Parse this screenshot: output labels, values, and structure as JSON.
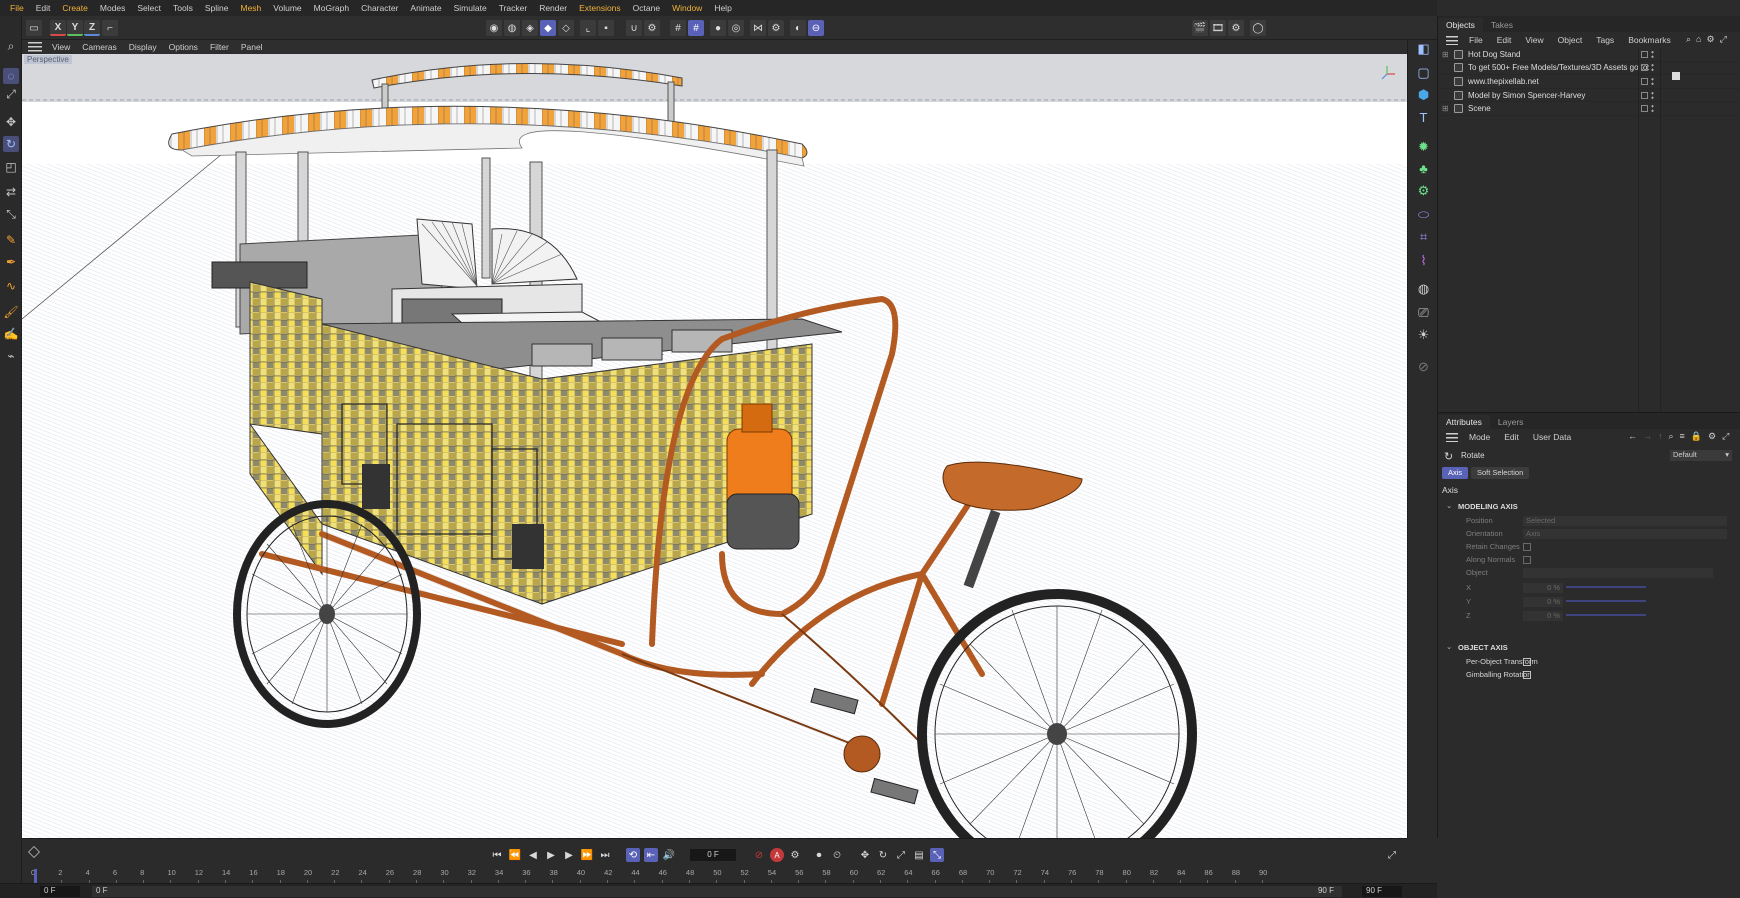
{
  "menubar": {
    "items": [
      {
        "label": "File",
        "hl": true
      },
      {
        "label": "Edit",
        "hl": false
      },
      {
        "label": "Create",
        "hl": true
      },
      {
        "label": "Modes",
        "hl": false
      },
      {
        "label": "Select",
        "hl": false
      },
      {
        "label": "Tools",
        "hl": false
      },
      {
        "label": "Spline",
        "hl": false
      },
      {
        "label": "Mesh",
        "hl": true
      },
      {
        "label": "Volume",
        "hl": false
      },
      {
        "label": "MoGraph",
        "hl": false
      },
      {
        "label": "Character",
        "hl": false
      },
      {
        "label": "Animate",
        "hl": false
      },
      {
        "label": "Simulate",
        "hl": false
      },
      {
        "label": "Tracker",
        "hl": false
      },
      {
        "label": "Render",
        "hl": false
      },
      {
        "label": "Extensions",
        "hl": true
      },
      {
        "label": "Octane",
        "hl": false
      },
      {
        "label": "Window",
        "hl": true
      },
      {
        "label": "Help",
        "hl": false
      }
    ]
  },
  "toolbar": {
    "axis_x": "X",
    "axis_y": "Y",
    "axis_z": "Z"
  },
  "viewport_menu": {
    "items": [
      "View",
      "Cameras",
      "Display",
      "Options",
      "Filter",
      "Panel"
    ],
    "camera_label": "Perspective"
  },
  "objects_panel": {
    "tabs": [
      "Objects",
      "Takes"
    ],
    "menu": [
      "File",
      "Edit",
      "View",
      "Object",
      "Tags",
      "Bookmarks"
    ],
    "rows": [
      {
        "name": "Hot Dog Stand",
        "expandable": true
      },
      {
        "name": "To get 500+ Free Models/Textures/3D Assets go to:",
        "expandable": false
      },
      {
        "name": "www.thepixellab.net",
        "expandable": false
      },
      {
        "name": "Model by Simon Spencer-Harvey",
        "expandable": false
      },
      {
        "name": "Scene",
        "expandable": true
      }
    ]
  },
  "attributes_panel": {
    "tabs": [
      "Attributes",
      "Layers"
    ],
    "menu": [
      "Mode",
      "Edit",
      "User Data"
    ],
    "tool_name": "Rotate",
    "preset": "Default",
    "subtabs": [
      "Axis",
      "Soft Selection"
    ],
    "section_title": "Axis",
    "modeling_axis": {
      "title": "MODELING AXIS",
      "position_label": "Position",
      "position_value": "Selected",
      "orientation_label": "Orientation",
      "orientation_value": "Axis",
      "retain_changes_label": "Retain Changes",
      "along_normals_label": "Along Normals",
      "object_label": "Object",
      "x_label": "X",
      "x_value": "0 %",
      "y_label": "Y",
      "y_value": "0 %",
      "z_label": "Z",
      "z_value": "0 %"
    },
    "object_axis": {
      "title": "OBJECT AXIS",
      "per_object_label": "Per-Object Transform",
      "gimballing_label": "Gimballing Rotation"
    }
  },
  "timeline": {
    "current_frame": "0 F",
    "ruler_ticks": [
      "0",
      "2",
      "4",
      "6",
      "8",
      "10",
      "12",
      "14",
      "16",
      "18",
      "20",
      "22",
      "24",
      "26",
      "28",
      "30",
      "32",
      "34",
      "36",
      "38",
      "40",
      "42",
      "44",
      "46",
      "48",
      "50",
      "52",
      "54",
      "56",
      "58",
      "60",
      "62",
      "64",
      "66",
      "68",
      "70",
      "72",
      "74",
      "76",
      "78",
      "80",
      "82",
      "84",
      "86",
      "88",
      "90"
    ],
    "start_frame": "0 F",
    "min_frame": "0 F",
    "max_frame": "90 F",
    "end_frame": "90 F"
  }
}
